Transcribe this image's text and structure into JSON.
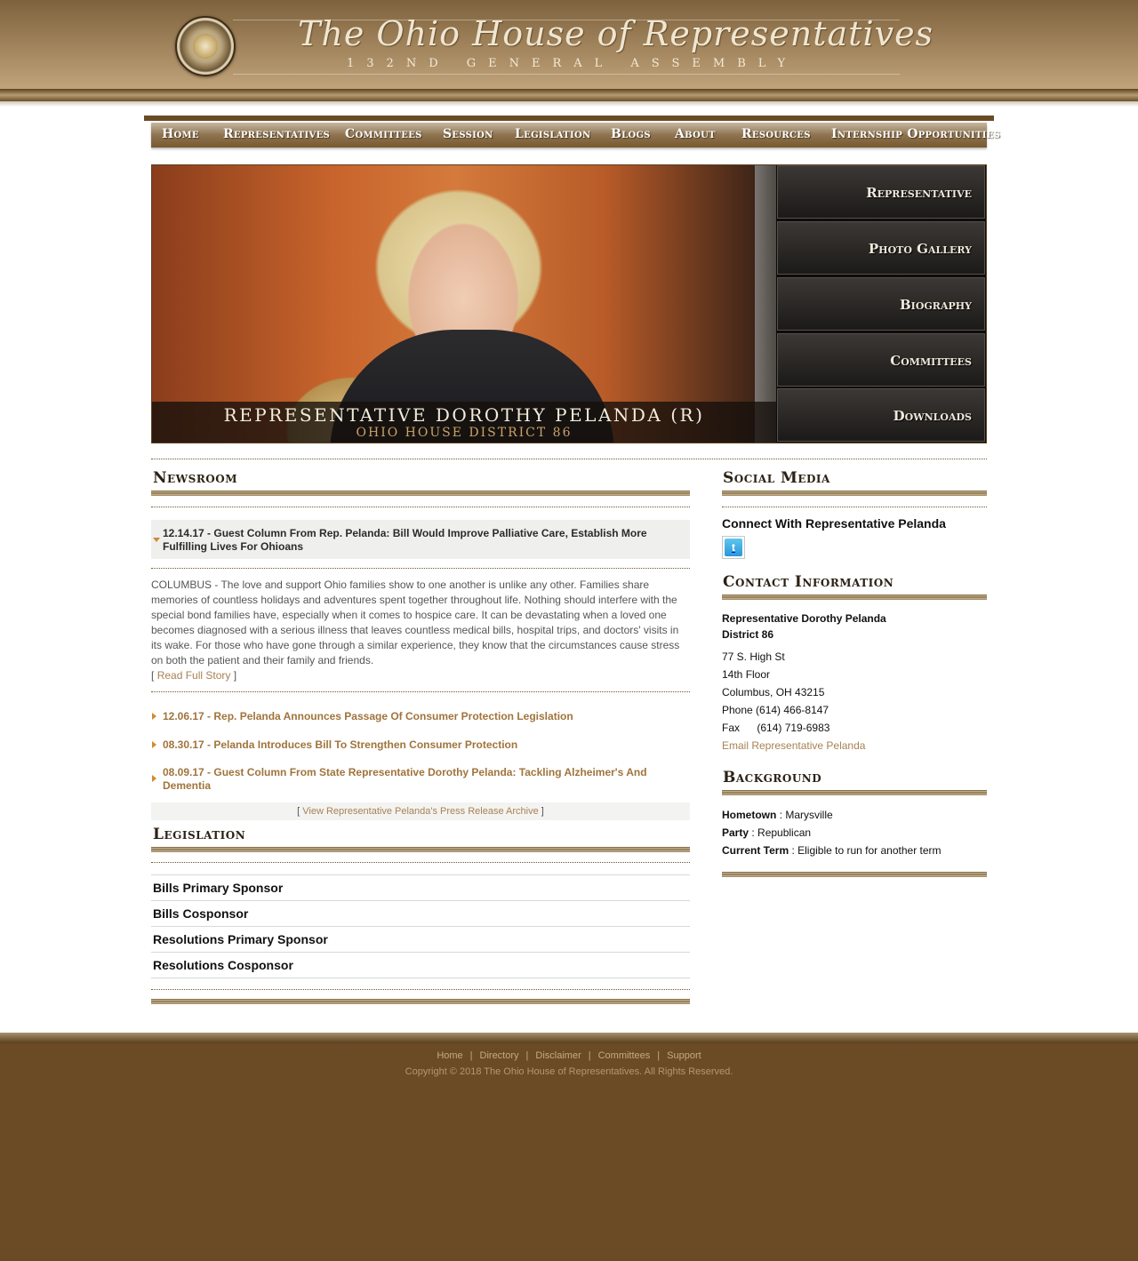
{
  "header": {
    "title": "The Ohio House of Representatives",
    "subtitle": "132ND GENERAL ASSEMBLY",
    "seal_text": "THE OHIO HOUSE OF REPRESENTATIVES"
  },
  "nav": {
    "items": [
      {
        "label": "Home"
      },
      {
        "label": "Representatives"
      },
      {
        "label": "Committees"
      },
      {
        "label": "Session"
      },
      {
        "label": "Legislation"
      },
      {
        "label": "Blogs"
      },
      {
        "label": "About"
      },
      {
        "label": "Resources"
      },
      {
        "label": "Internship Opportunities"
      }
    ]
  },
  "hero": {
    "name": "REPRESENTATIVE DOROTHY PELANDA (R)",
    "district": "OHIO HOUSE DISTRICT 86",
    "menu": [
      {
        "label": "Representative"
      },
      {
        "label": "Photo Gallery"
      },
      {
        "label": "Biography"
      },
      {
        "label": "Committees"
      },
      {
        "label": "Downloads"
      }
    ]
  },
  "newsroom": {
    "heading": "Newsroom",
    "featured": {
      "title": "12.14.17 - Guest Column From Rep. Pelanda: Bill Would Improve Palliative Care, Establish More Fulfilling Lives For Ohioans",
      "body": "COLUMBUS - The love and support Ohio families show to one another is unlike any other. Families share memories of countless holidays and adventures spent together throughout life. Nothing should interfere with the special bond families have, especially when it comes to hospice care. It can be devastating when a loved one becomes diagnosed with a serious illness that leaves countless medical bills, hospital trips, and doctors' visits in its wake. For those who have gone through a similar experience, they know that the circumstances cause stress on both the patient and their family and friends.",
      "read_more_open": "[",
      "read_more": "Read Full Story",
      "read_more_close": "]"
    },
    "items": [
      {
        "title": "12.06.17 - Rep. Pelanda Announces Passage Of Consumer Protection Legislation"
      },
      {
        "title": "08.30.17 - Pelanda Introduces Bill To Strengthen Consumer Protection"
      },
      {
        "title": "08.09.17 - Guest Column From State Representative Dorothy Pelanda: Tackling Alzheimer's And Dementia"
      }
    ],
    "archive_open": "[",
    "archive_link": "View Representative Pelanda's Press Release Archive",
    "archive_close": "]"
  },
  "legislation": {
    "heading": "Legislation",
    "rows": [
      {
        "label": "Bills Primary Sponsor"
      },
      {
        "label": "Bills Cosponsor"
      },
      {
        "label": "Resolutions Primary Sponsor"
      },
      {
        "label": "Resolutions Cosponsor"
      }
    ]
  },
  "social": {
    "heading": "Social Media",
    "connect": "Connect With Representative Pelanda",
    "twitter_icon": "twitter-icon"
  },
  "contact": {
    "heading": "Contact Information",
    "name": "Representative Dorothy Pelanda",
    "district": "District 86",
    "address1": "77 S. High St",
    "address2": "14th Floor",
    "city": "Columbus, OH 43215",
    "phone": "Phone (614) 466-8147",
    "fax_label": "Fax",
    "fax": "(614) 719-6983",
    "email_link": "Email Representative Pelanda"
  },
  "background": {
    "heading": "Background",
    "hometown_label": "Hometown",
    "hometown": " : Marysville",
    "party_label": "Party",
    "party": " : Republican",
    "term_label": "Current Term",
    "term": " : Eligible to run for another term"
  },
  "footer": {
    "links": [
      {
        "label": "Home"
      },
      {
        "label": "Directory"
      },
      {
        "label": "Disclaimer"
      },
      {
        "label": "Committees"
      },
      {
        "label": "Support"
      }
    ],
    "separator": "|",
    "copyright": "Copyright © 2018 The Ohio House of Representatives. All Rights Reserved."
  },
  "colors": {
    "brand_brown": "#6b4b26",
    "link_gold": "#a0743c",
    "accent_orange": "#d08a33"
  }
}
